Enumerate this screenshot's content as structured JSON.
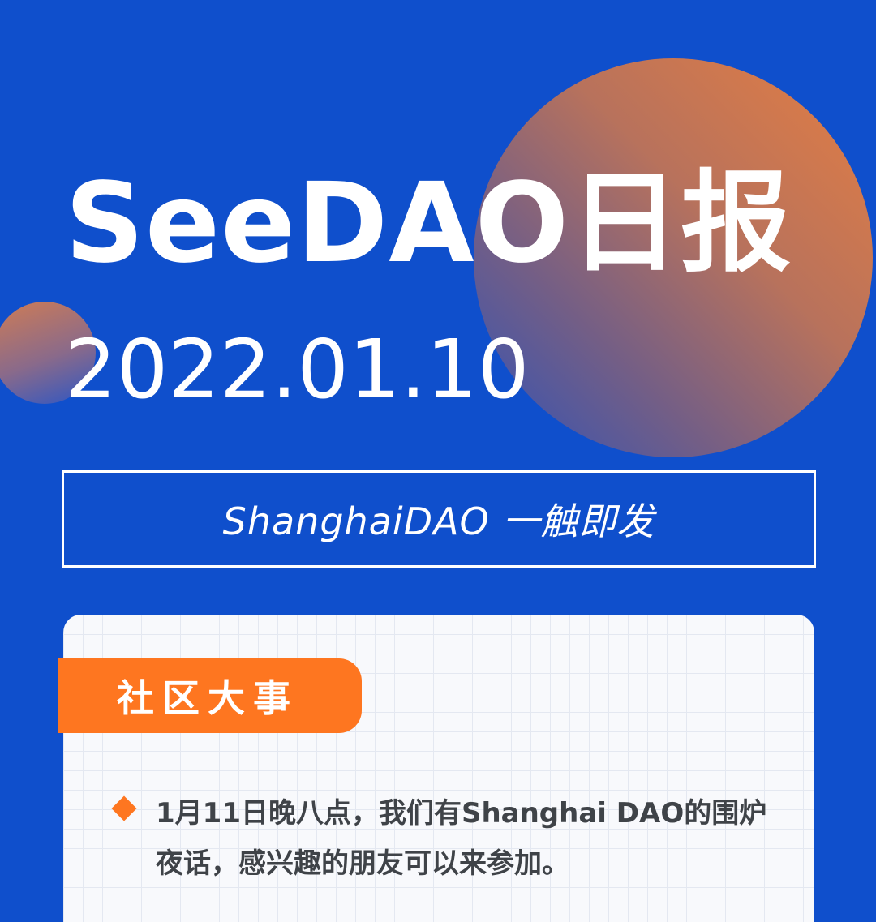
{
  "header": {
    "title": "SeeDAO日报",
    "date": "2022.01.10"
  },
  "slogan": "ShanghaiDAO 一触即发",
  "section": {
    "label": "社区大事",
    "items": [
      {
        "text": "1月11日晚八点，我们有Shanghai DAO的围炉夜话，感兴趣的朋友可以来参加。"
      }
    ]
  },
  "colors": {
    "background": "#0f4fcc",
    "accent": "#fe7620",
    "card": "#f8f9fc",
    "text": "#3f4348"
  },
  "icons": {
    "bullet": "diamond-bullet-icon"
  }
}
